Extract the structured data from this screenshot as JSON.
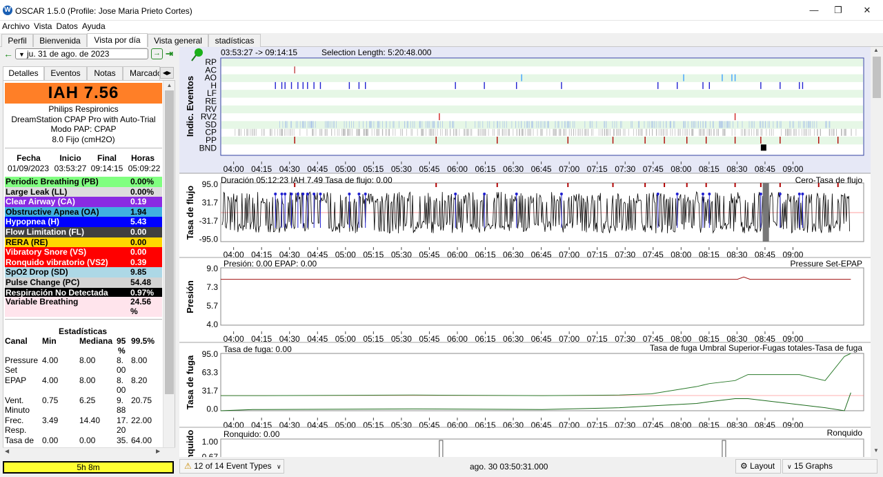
{
  "window": {
    "title": "OSCAR 1.5.0 (Profile: Jose Maria Prieto Cortes)",
    "logo": "W"
  },
  "menu": [
    "Archivo",
    "Vista",
    "Datos",
    "Ayuda"
  ],
  "tabs": [
    "Perfil",
    "Bienvenida",
    "Vista por día",
    "Vista general",
    "stadísticas"
  ],
  "date": {
    "value": "ju. 31 de ago. de 2023"
  },
  "subtabs": [
    "Detalles",
    "Eventos",
    "Notas",
    "Marcado"
  ],
  "summary": {
    "iah": "IAH  7.56",
    "device": [
      "Philips Respironics",
      "DreamStation CPAP Pro with Auto-Trial",
      "Modo PAP: CPAP",
      "8.0 Fijo (cmH2O)"
    ],
    "headers": [
      "Fecha",
      "Inicio",
      "Final",
      "Horas"
    ],
    "values": [
      "01/09/2023",
      "03:53:27",
      "09:14:15",
      "05:09:22"
    ]
  },
  "events": [
    {
      "name": "Periodic Breathing (PB)",
      "value": "0.00%",
      "bg": "#80ff80",
      "fg": "#000000"
    },
    {
      "name": "Large Leak (LL)",
      "value": "0.00%",
      "bg": "#dddddd",
      "fg": "#000000"
    },
    {
      "name": "Clear Airway (CA)",
      "value": "0.19",
      "bg": "#8a2be2",
      "fg": "#ffffff"
    },
    {
      "name": "Obstructive Apnea (OA)",
      "value": "1.94",
      "bg": "#40b0e0",
      "fg": "#000000"
    },
    {
      "name": "Hypopnea (H)",
      "value": "5.43",
      "bg": "#0000ff",
      "fg": "#ffffff"
    },
    {
      "name": "Flow Limitation (FL)",
      "value": "0.00",
      "bg": "#404040",
      "fg": "#ffffff"
    },
    {
      "name": "RERA (RE)",
      "value": "0.00",
      "bg": "#ffd700",
      "fg": "#000000"
    },
    {
      "name": "Vibratory Snore (VS)",
      "value": "0.00",
      "bg": "#ff0000",
      "fg": "#ffffff"
    },
    {
      "name": "Ronquido vibratorio (VS2)",
      "value": "0.39",
      "bg": "#ff0000",
      "fg": "#ffffff"
    },
    {
      "name": "SpO2 Drop (SD)",
      "value": "9.85",
      "bg": "#add8e6",
      "fg": "#000000"
    },
    {
      "name": "Pulse Change (PC)",
      "value": "54.48",
      "bg": "#d3d3d3",
      "fg": "#000000"
    },
    {
      "name": "Respiración No Detectada",
      "value": "0.97%",
      "bg": "#000000",
      "fg": "#ffffff"
    }
  ],
  "variable_breathing": {
    "name": "Variable Breathing",
    "value": "24.56",
    "unit": "%",
    "bg": "#ffe4ec"
  },
  "stats": {
    "title": "Estadísticas",
    "headers": {
      "canal": "Canal",
      "min": "Min",
      "mediana": "Mediana",
      "p95": "95",
      "p95b": "%",
      "p995": "99.5%"
    },
    "rows": [
      {
        "l1": "Pressure",
        "l2": "Set",
        "min": "4.00",
        "med": "8.00",
        "p95a": "8.",
        "p95b": "00",
        "p995": "8.00"
      },
      {
        "l1": "EPAP",
        "l2": "",
        "min": "4.00",
        "med": "8.00",
        "p95a": "8.",
        "p95b": "00",
        "p995": "8.20"
      },
      {
        "l1": "Vent.",
        "l2": "Minuto",
        "min": "0.75",
        "med": "6.25",
        "p95a": "9.",
        "p95b": "88",
        "p995": "20.75"
      },
      {
        "l1": "Frec.",
        "l2": "Resp.",
        "min": "3.49",
        "med": "14.40",
        "p95a": "17.",
        "p95b": "20",
        "p995": "22.00"
      },
      {
        "l1": "Tasa de",
        "l2": "",
        "min": "0.00",
        "med": "0.00",
        "p95a": "35.",
        "p95b": "",
        "p995": "64.00"
      }
    ]
  },
  "status": {
    "duration": "5h 8m",
    "event_types": "12 of 14 Event Types",
    "timestamp": "ago. 30 03:50:31.000",
    "layout": "Layout",
    "graphs": "15 Graphs"
  },
  "time_ticks": [
    "04:00",
    "04:15",
    "04:30",
    "04:45",
    "05:00",
    "05:15",
    "05:30",
    "05:45",
    "06:00",
    "06:15",
    "06:30",
    "06:45",
    "07:00",
    "07:15",
    "07:30",
    "07:45",
    "08:00",
    "08:15",
    "08:30",
    "08:45",
    "09:00"
  ],
  "chart_data": [
    {
      "type": "scatter",
      "title": "Indic. Eventos",
      "range_text": "03:53:27 -> 09:14:15",
      "selection_text": "Selection Length: 5:20:48.000",
      "ylabel": "Indic. Eventos",
      "categories": [
        "RP",
        "AC",
        "AO",
        "H",
        "LF",
        "RE",
        "RV",
        "RV2",
        "SD",
        "CP",
        "PP",
        "BND"
      ],
      "xlim": [
        0,
        1
      ],
      "events": {
        "AC": [
          0.115
        ],
        "AO": [
          0.468,
          0.72,
          0.78,
          0.795,
          0.8
        ],
        "H": [
          0.085,
          0.095,
          0.1,
          0.11,
          0.12,
          0.128,
          0.135,
          0.145,
          0.155,
          0.2,
          0.215,
          0.225,
          0.365,
          0.41,
          0.46,
          0.53,
          0.68,
          0.71,
          0.75,
          0.76,
          0.84,
          0.87,
          0.9,
          0.905
        ],
        "RV2": [
          0.34,
          0.8
        ],
        "PP": [
          0.115,
          0.335,
          0.43,
          0.54,
          0.61,
          0.66,
          0.69,
          0.725,
          0.755,
          0.8,
          0.84,
          0.87,
          0.93,
          0.96
        ]
      },
      "bnd": [
        0.84,
        0.85
      ]
    },
    {
      "type": "line",
      "title": "Tasa de flujo",
      "header_text": "Duración 05:12:23 IAH 7.49 Tasa de flujo: 0.00",
      "legend": "Cero-Tasa de flujo",
      "ylabel": "Tasa de flujo",
      "yticks": [
        "95.0",
        "31.7",
        "-31.7",
        "-95.0"
      ],
      "ylim": [
        -95,
        95
      ]
    },
    {
      "type": "line",
      "title": "Presión",
      "header_text": "Presión: 0.00 EPAP: 0.00",
      "legend": "Pressure Set-EPAP",
      "ylabel": "Presión",
      "yticks": [
        "9.0",
        "7.3",
        "5.7",
        "4.0"
      ],
      "ylim": [
        4,
        9
      ],
      "series": [
        {
          "name": "Pressure Set",
          "x": [
            0,
            0.82,
            0.83,
            0.84,
            1
          ],
          "y": [
            8,
            8,
            8.2,
            8,
            8
          ]
        }
      ]
    },
    {
      "type": "line",
      "title": "Tasa de fuga",
      "header_text": "Tasa de fuga: 0.00",
      "legend": "Tasa de fuga Umbral Superior-Fugas totales-Tasa de fuga",
      "ylabel": "Tasa de fuga",
      "yticks": [
        "95.0",
        "63.3",
        "31.7",
        "0.0"
      ],
      "ylim": [
        0,
        95
      ],
      "series": [
        {
          "name": "Fugas totales",
          "x": [
            0,
            0.05,
            0.3,
            0.5,
            0.62,
            0.67,
            0.74,
            0.76,
            0.8,
            0.82,
            0.9,
            0.94,
            0.97,
            0.98
          ],
          "y": [
            25,
            25,
            26,
            25,
            26,
            28,
            40,
            45,
            50,
            60,
            60,
            50,
            90,
            95
          ]
        },
        {
          "name": "Tasa de fuga",
          "x": [
            0,
            0.05,
            0.3,
            0.5,
            0.62,
            0.67,
            0.74,
            0.76,
            0.8,
            0.82,
            0.9,
            0.94,
            0.97,
            0.98
          ],
          "y": [
            0,
            2,
            3,
            2,
            5,
            8,
            12,
            15,
            20,
            20,
            10,
            5,
            0,
            30
          ]
        }
      ]
    },
    {
      "type": "line",
      "title": "Ronquido",
      "header_text": "Ronquido: 0.00",
      "legend": "Ronquido",
      "ylabel": "Ronquido",
      "yticks": [
        "1.00",
        "0.67"
      ]
    }
  ]
}
